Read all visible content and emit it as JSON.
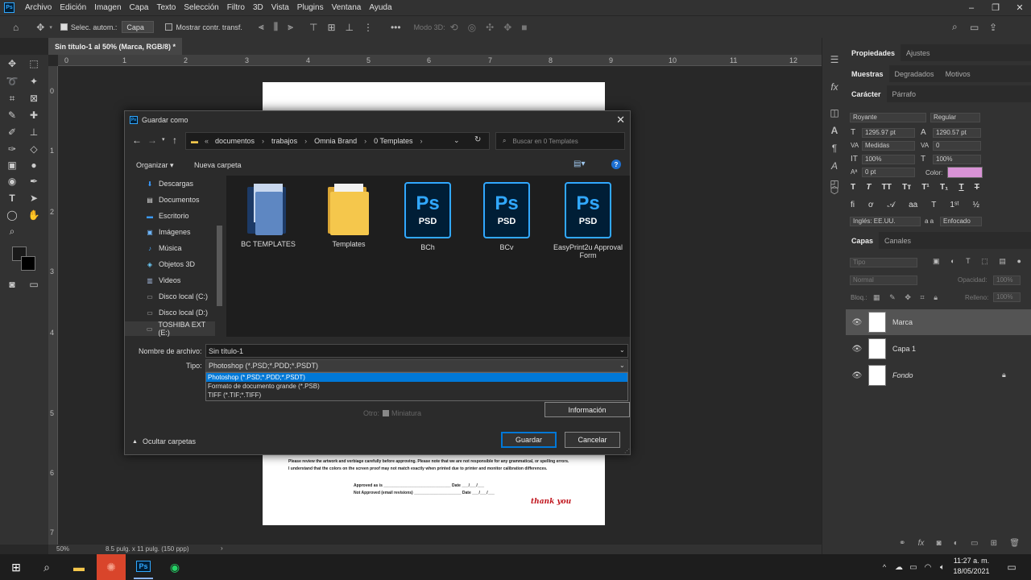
{
  "menubar": {
    "logo": "Ps",
    "items": [
      "Archivo",
      "Edición",
      "Imagen",
      "Capa",
      "Texto",
      "Selección",
      "Filtro",
      "3D",
      "Vista",
      "Plugins",
      "Ventana",
      "Ayuda"
    ]
  },
  "options": {
    "auto_select_label": "Selec. autom.:",
    "auto_select_value": "Capa",
    "show_transform_label": "Mostrar contr. transf.",
    "mode3d_label": "Modo 3D:"
  },
  "document_tab": {
    "title": "Sin título-1 al 50% (Marca, RGB/8) *"
  },
  "ruler_top_ticks": [
    "0",
    "1",
    "2",
    "3",
    "4",
    "5",
    "6",
    "7",
    "8",
    "9",
    "10",
    "11",
    "12",
    "13"
  ],
  "ruler_left_ticks": [
    "0",
    "1",
    "2",
    "3",
    "4",
    "5",
    "6",
    "7",
    "8"
  ],
  "document_text": {
    "line1": "Please review the artwork and verbiage carefully before approving. Please note that we are not responsible for any grammatical, or spelling errors.",
    "line2": "I understand that the colors on the screen proof may not match exactly when printed due to printer and monitor calibration differences.",
    "approved": "Approved as is ______________________________ Date ___/___/___",
    "not_approved": "Not Approved (email revisions) _____________________ Date ___/___/___",
    "thank_you": "thank you"
  },
  "status": {
    "zoom": "50%",
    "doc_size": "8.5 pulg. x 11 pulg. (150 ppp)"
  },
  "panels": {
    "props_tabs": [
      "Propiedades",
      "Ajustes"
    ],
    "swatch_tabs": [
      "Muestras",
      "Degradados",
      "Motivos"
    ],
    "char_tabs": [
      "Carácter",
      "Párrafo"
    ],
    "font_family": "Royante",
    "font_style": "Regular",
    "font_size": "1295.97 pt",
    "leading": "1290.57 pt",
    "kerning": "Medidas",
    "tracking": "0",
    "vscale": "100%",
    "hscale": "100%",
    "baseline": "0 pt",
    "color_label": "Color:",
    "text_color": "#d993d6",
    "language": "Inglés: EE.UU.",
    "aa_label": "a a",
    "antialias": "Enfocado",
    "layers_tabs": [
      "Capas",
      "Canales"
    ],
    "filter_placeholder": "Tipo",
    "blend_mode": "Normal",
    "opacity_label": "Opacidad:",
    "opacity": "100%",
    "lock_label": "Bloq.:",
    "fill_label": "Relleno:",
    "fill": "100%",
    "layers": [
      "Marca",
      "Capa 1",
      "Fondo"
    ]
  },
  "dialog": {
    "title": "Guardar como",
    "path": [
      "documentos",
      "trabajos",
      "Omnia Brand",
      "0 Templates"
    ],
    "path_prefix": "«",
    "search_placeholder": "Buscar en 0 Templates",
    "organize": "Organizar ▾",
    "new_folder": "Nueva carpeta",
    "nav_items": [
      "Descargas",
      "Documentos",
      "Escritorio",
      "Imágenes",
      "Música",
      "Objetos 3D",
      "Videos",
      "Disco local (C:)",
      "Disco local (D:)",
      "TOSHIBA EXT (E:)"
    ],
    "files": [
      {
        "name": "BC TEMPLATES",
        "kind": "folder-docs"
      },
      {
        "name": "Templates",
        "kind": "folder"
      },
      {
        "name": "BCh",
        "kind": "psd"
      },
      {
        "name": "BCv",
        "kind": "psd"
      },
      {
        "name": "EasyPrint2u Approval Form",
        "kind": "psd"
      }
    ],
    "psd_label": "PSD",
    "ps_label": "Ps",
    "filename_label": "Nombre de archivo:",
    "filename_value": "Sin título-1",
    "type_label": "Tipo:",
    "type_value": "Photoshop (*.PSD;*.PDD;*.PSDT)",
    "type_options": [
      "Photoshop (*.PSD;*.PDD;*.PSDT)",
      "Formato de documento grande (*.PSB)",
      "TIFF (*.TIF;*.TIFF)"
    ],
    "other_label": "Otro:",
    "thumbnail_label": "Miniatura",
    "info_button": "Información",
    "hide_folders": "Ocultar carpetas",
    "save_button": "Guardar",
    "cancel_button": "Cancelar"
  },
  "taskbar": {
    "time": "11:27 a. m.",
    "date": "18/05/2021"
  }
}
